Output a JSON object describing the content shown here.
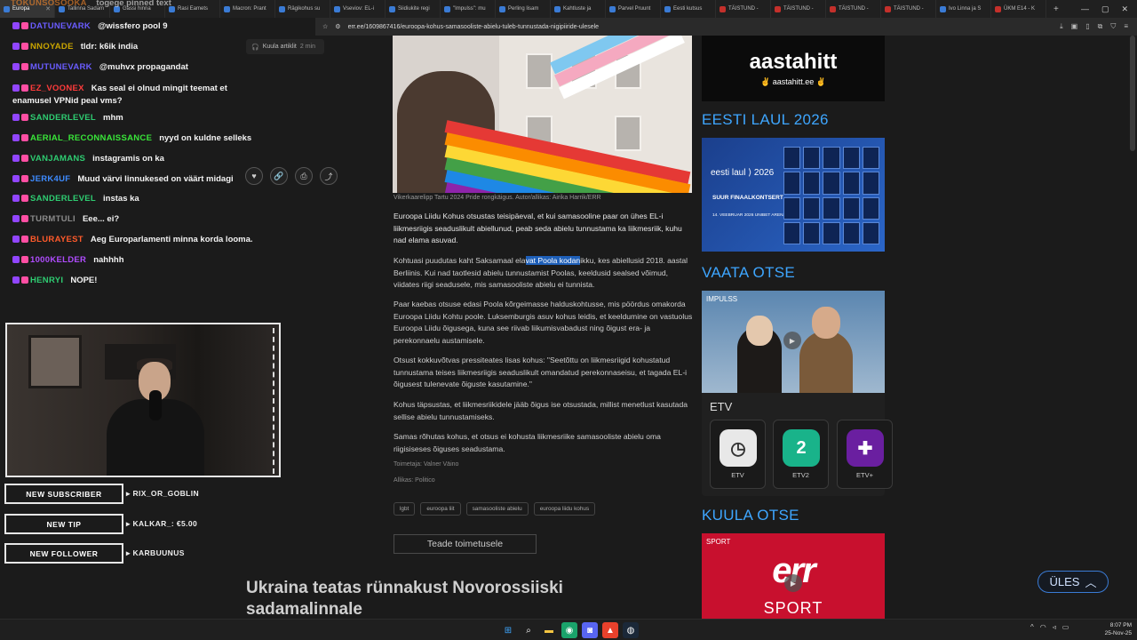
{
  "browser": {
    "tabs": [
      {
        "label": "Europa",
        "active": true
      },
      {
        "label": "Tallinna Sadam"
      },
      {
        "label": "Gassi hinna"
      },
      {
        "label": "Rasi Eamets"
      },
      {
        "label": "Macron: Prant"
      },
      {
        "label": "Rägikohus su"
      },
      {
        "label": "Vseviov: EL-i"
      },
      {
        "label": "Siidiukite regi"
      },
      {
        "label": "\"Impulss\": mu"
      },
      {
        "label": "Perling lisam"
      },
      {
        "label": "Kahtluste ja"
      },
      {
        "label": "Parvel Pruunt"
      },
      {
        "label": "Eesti kutsus"
      },
      {
        "label": "TÄISTUND -",
        "yt": true
      },
      {
        "label": "TÄISTUND -",
        "yt": true
      },
      {
        "label": "TÄISTUND -",
        "yt": true
      },
      {
        "label": "TÄISTUND -",
        "yt": true
      },
      {
        "label": "Ivo Linna ja S"
      },
      {
        "label": "ÜKM E14 - K",
        "yt": true
      }
    ],
    "url": "err.ee/1609867416/euroopa-kohus-samasooliste-abielu-tuleb-tunnustada-nigipiiride-ulesele"
  },
  "chat": {
    "partial_top": {
      "user": "TOKUNSOSOOKA",
      "text": "togege pinned text"
    },
    "messages": [
      {
        "user": "DATUNEVARK",
        "color": "#6a5cff",
        "text": "@wissfero pool 9"
      },
      {
        "user": "NNOYADE",
        "color": "#c9a400",
        "text": "tldr: k6ik india"
      },
      {
        "user": "MUTUNEVARK",
        "color": "#6a5cff",
        "text": "@muhvx propagandat"
      },
      {
        "user": "EZ_VOONEX",
        "color": "#ff3b3b",
        "text": "Kas seal ei olnud mingit teemat et enamusel VPNid peal vms?"
      },
      {
        "user": "SANDERLEVEL",
        "color": "#2ecc71",
        "text": "mhm"
      },
      {
        "user": "AERIAL_RECONNAISSANCE",
        "color": "#39e639",
        "text": "nyyd on kuldne selleks"
      },
      {
        "user": "VANJAMANS",
        "color": "#2ecc71",
        "text": "instagramis on ka"
      },
      {
        "user": "JERK4UF",
        "color": "#3e8bff",
        "text": "Muud värvi linnukesed on väärt midagi"
      },
      {
        "user": "SANDERLEVEL",
        "color": "#2ecc71",
        "text": "instas ka"
      },
      {
        "user": "TURMTULI",
        "color": "#8a8a8a",
        "text": "Eee... ei?"
      },
      {
        "user": "BLURAYEST",
        "color": "#ff5a2b",
        "text": "Aeg Europarlamenti minna korda looma."
      },
      {
        "user": "1000KELDER",
        "color": "#b04cff",
        "text": "nahhhh"
      },
      {
        "user": "HENRYI",
        "color": "#2ecc71",
        "text": "NOPE!"
      }
    ]
  },
  "listen": {
    "label": "Kuula artiklit",
    "duration": "2 min"
  },
  "alerts": [
    {
      "label": "NEW SUBSCRIBER",
      "value": "RIX_OR_GOBLIN"
    },
    {
      "label": "NEW TIP",
      "value": "KALKAR_: €5.00"
    },
    {
      "label": "NEW FOLLOWER",
      "value": "KARBUUNUS"
    }
  ],
  "article": {
    "caption": "Vikerkaarelipp Tartu 2024 Pride rongkäigus. Autor/allikas: Airika Harrik/ERR",
    "lead": "Euroopa Liidu Kohus otsustas teisipäeval, et kui samasooline paar on ühes EL-i liikmesriigis seaduslikult abiellunud, peab seda abielu tunnustama ka liikmesriik, kuhu nad elama asuvad.",
    "p2_before": "Kohtuasi puudutas kaht Saksamaal ela",
    "p2_highlight": "vat Poola kodan",
    "p2_after": "ikku, kes abiellusid 2018. aastal Berliinis. Kui nad taotlesid abielu tunnustamist Poolas, keeldusid sealsed võimud, viidates riigi seadusele, mis samasooliste abielu ei tunnista.",
    "p3": "Paar kaebas otsuse edasi Poola kõrgeimasse halduskohtusse, mis pöördus omakorda Euroopa Liidu Kohtu poole. Luksemburgis asuv kohus leidis, et keeldumine on vastuolus Euroopa Liidu õigusega, kuna see riivab liikumisvabadust ning õigust era- ja perekonnaelu austamisele.",
    "p4": "Otsust kokkuvõtvas pressiteates lisas kohus: \"Seetõttu on liikmesriigid kohustatud tunnustama teises liikmesriigis seaduslikult omandatud perekonnaseisu, et tagada EL-i õigusest tulenevate õiguste kasutamine.\"",
    "p5": "Kohus täpsustas, et liikmesriikidele jääb õigus ise otsustada, millist menetlust kasutada sellise abielu tunnustamiseks.",
    "p6": "Samas rõhutas kohus, et otsus ei kohusta liikmesriike samasooliste abielu oma riigisiseses õiguses seadustama.",
    "editor": "Toimetaja: Valner Väino",
    "source": "Allikas: Politico",
    "tags": [
      "lgbt",
      "euroopa liit",
      "samasooliste abielu",
      "euroopa liidu kohus"
    ],
    "send_label": "Teade toimetusele",
    "next_headline": "Ukraina teatas rünnakust Novorossiiski sadamalinnale"
  },
  "sidebar": {
    "aastahitt_big": "aastahitt",
    "aastahitt_small": "✌ aastahitt.ee ✌",
    "eesti_laul_title": "EESTI LAUL 2026",
    "eesti_laul_logo": "eesti laul ⟩ 2026",
    "eesti_laul_event": "SUUR FINAALKONTSERT",
    "eesti_laul_date": "14. VEEBRUAR 2026 UNIBET ARENA",
    "vaata_title": "VAATA OTSE",
    "impulss_label": "IMPULSS",
    "etv_label": "ETV",
    "channels": [
      {
        "name": "ETV",
        "glyph": "◷",
        "bg": "#e8e8e8",
        "fg": "#333"
      },
      {
        "name": "ETV2",
        "glyph": "2",
        "bg": "#19b38a",
        "fg": "#fff"
      },
      {
        "name": "ETV+",
        "glyph": "✚",
        "bg": "#6a1fa0",
        "fg": "#fff"
      }
    ],
    "kuula_title": "KUULA OTSE",
    "sport_label": "SPORT",
    "err_logo": "err",
    "err_sport": "SPORT"
  },
  "ules_label": "ÜLES",
  "clock": {
    "time": "8:07 PM",
    "date": "25-Nov-25"
  },
  "colors": {
    "accent": "#3ea6ff",
    "highlight": "#1e5fb8",
    "err_red": "#c8102e"
  }
}
